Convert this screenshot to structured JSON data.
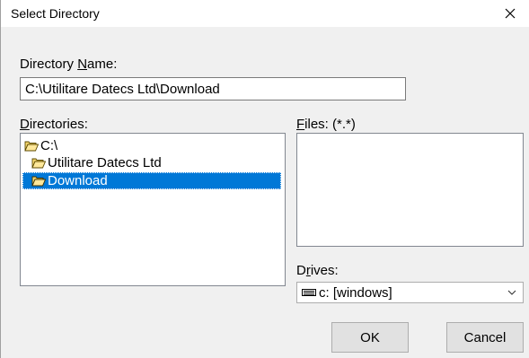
{
  "window": {
    "title": "Select Directory"
  },
  "directory_name": {
    "label_pre": "Directory ",
    "label_key": "N",
    "label_post": "ame:",
    "value": "C:\\Utilitare Datecs Ltd\\Download"
  },
  "directories": {
    "label_key": "D",
    "label_post": "irectories:",
    "items": [
      {
        "label": "C:\\",
        "icon": "open-folder-icon",
        "selected": false
      },
      {
        "label": "Utilitare Datecs Ltd",
        "icon": "open-folder-icon",
        "selected": false
      },
      {
        "label": "Download",
        "icon": "open-folder-icon",
        "selected": true
      }
    ]
  },
  "files": {
    "label_key": "F",
    "label_post": "iles: (*.*)",
    "items": []
  },
  "drives": {
    "label_pre": "D",
    "label_key": "r",
    "label_post": "ives:",
    "value": "c: [windows]",
    "icon": "drive-icon"
  },
  "buttons": {
    "ok": "OK",
    "cancel": "Cancel"
  },
  "colors": {
    "selection": "#0078d7",
    "folder": "#e6b800"
  }
}
